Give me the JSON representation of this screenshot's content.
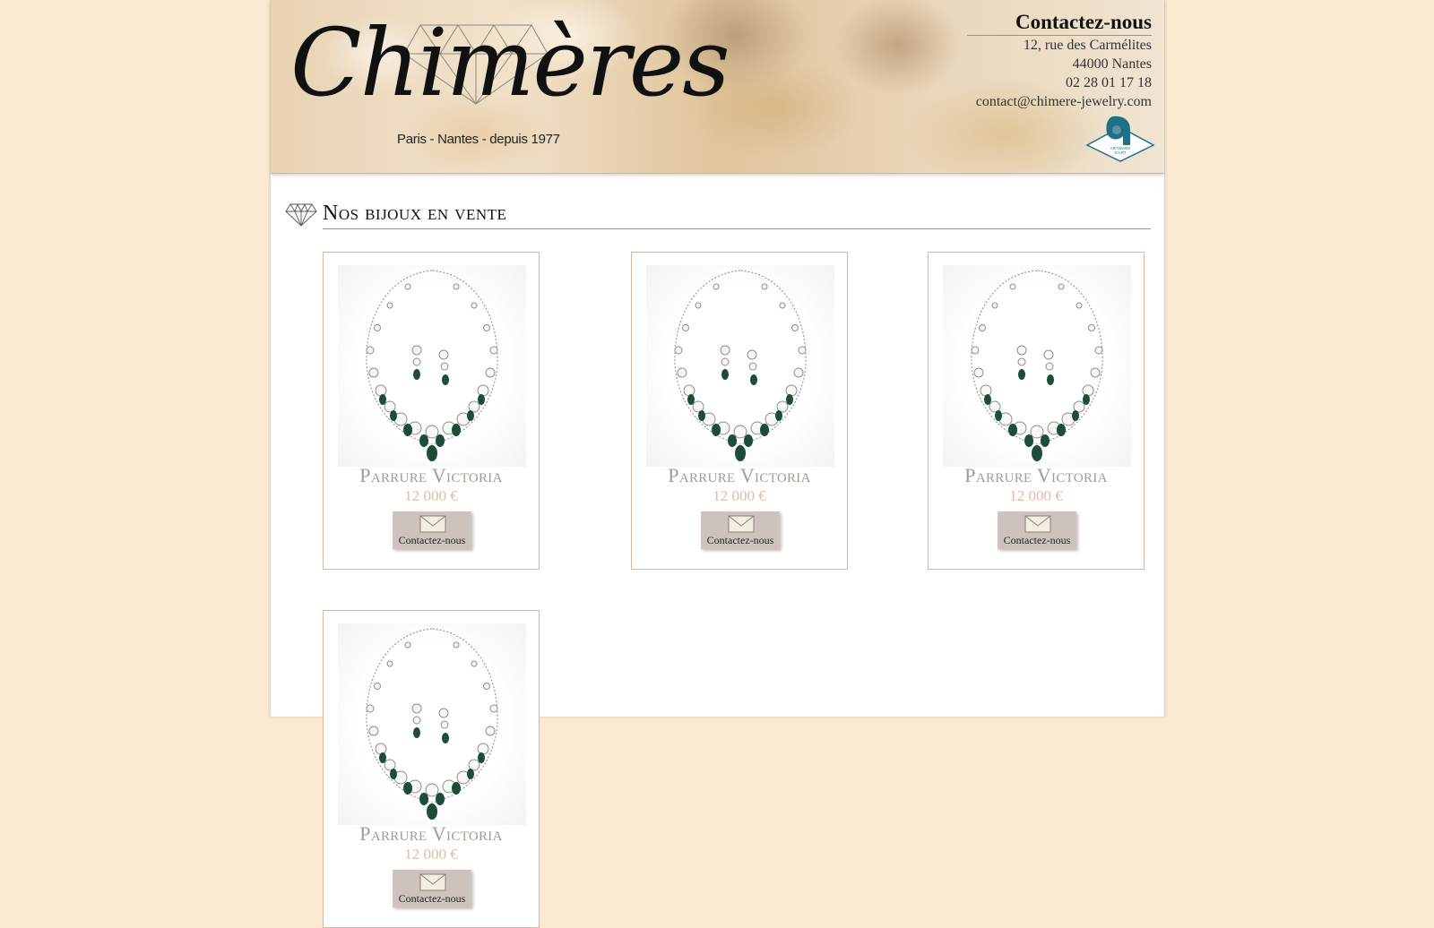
{
  "header": {
    "logo_text": "Chimères",
    "logo_subtitle": "Paris - Nantes - depuis 1977",
    "contact": {
      "title": "Contactez-nous",
      "street": "12, rue des Carmélites",
      "city": "44000 Nantes",
      "phone": "02 28 01 17 18",
      "email": "contact@chimere-jewelry.com"
    },
    "badge_text_line1": "ARTISANS",
    "badge_text_line2": "D'ART"
  },
  "section": {
    "title": "Nos bijoux en vente"
  },
  "products": [
    {
      "name": "Parrure Victoria",
      "price": "12 000 €",
      "button_label": "Contactez-nous"
    },
    {
      "name": "Parrure Victoria",
      "price": "12 000 €",
      "button_label": "Contactez-nous"
    },
    {
      "name": "Parrure Victoria",
      "price": "12 000 €",
      "button_label": "Contactez-nous"
    },
    {
      "name": "Parrure Victoria",
      "price": "12 000 €",
      "button_label": "Contactez-nous"
    }
  ],
  "colors": {
    "background": "#fbe8d3",
    "accent_line": "#b98a6a",
    "card_border": "#d9b89e",
    "product_name": "#a39a92",
    "price": "#e0bba4",
    "button_bg": "#cec3bc",
    "badge_teal": "#1f6f86"
  },
  "icons": {
    "logo_diamond": "diamond-outline-icon",
    "section_icon": "diamond-icon",
    "button_icon": "envelope-icon",
    "badge": "artisans-dart-badge"
  }
}
